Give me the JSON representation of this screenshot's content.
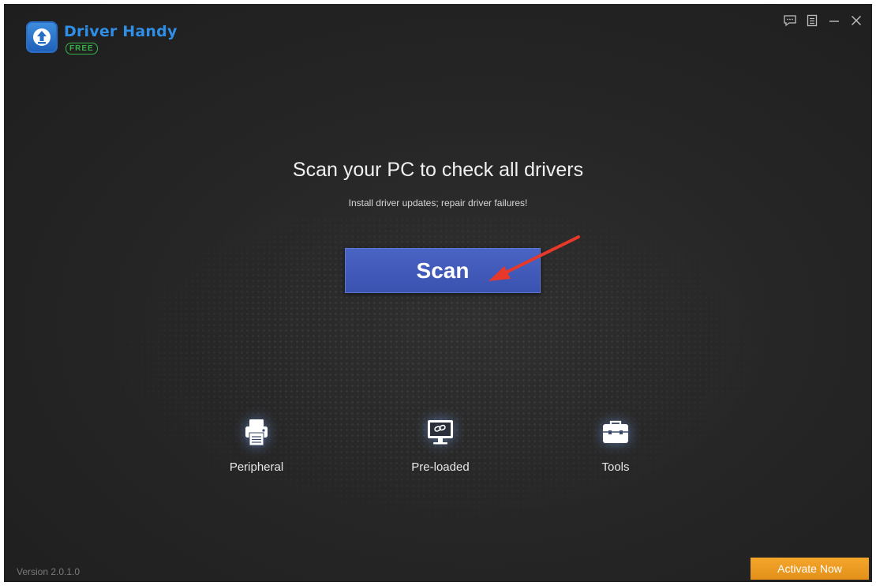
{
  "app": {
    "name": "Driver Handy",
    "edition_badge": "FREE"
  },
  "window_controls": [
    {
      "icon": "feedback-icon"
    },
    {
      "icon": "menu-icon"
    },
    {
      "icon": "minimize-icon"
    },
    {
      "icon": "close-icon"
    }
  ],
  "main": {
    "headline": "Scan your PC to check all drivers",
    "subline": "Install driver updates; repair driver failures!",
    "scan_label": "Scan"
  },
  "features": [
    {
      "label": "Peripheral",
      "icon": "printer-icon"
    },
    {
      "label": "Pre-loaded",
      "icon": "monitor-link-icon"
    },
    {
      "label": "Tools",
      "icon": "toolbox-icon"
    }
  ],
  "footer": {
    "version": "Version 2.0.1.0",
    "activate_label": "Activate Now"
  },
  "colors": {
    "background": "#262626",
    "brand_blue": "#2f8fe6",
    "free_green": "#37b34a",
    "scan_button": "#3f58b8",
    "activate_orange": "#f0a02a",
    "annotation_arrow": "#e8382a"
  }
}
